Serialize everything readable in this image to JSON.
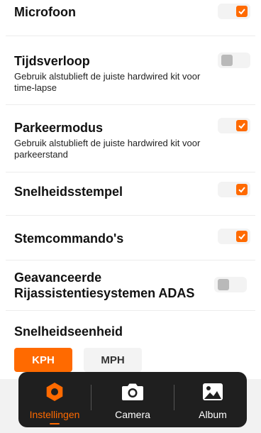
{
  "settings": {
    "microfoon": {
      "title": "Microfoon",
      "on": true
    },
    "tijdsverloop": {
      "title": "Tijdsverloop",
      "sub": "Gebruik alstublieft de juiste hardwired kit voor time-lapse",
      "on": false
    },
    "parkeermodus": {
      "title": "Parkeermodus",
      "sub": "Gebruik alstublieft de juiste hardwired kit voor parkeerstand",
      "on": true
    },
    "snelheidsstempel": {
      "title": "Snelheidsstempel",
      "on": true
    },
    "stemcommandos": {
      "title": "Stemcommando's",
      "on": true
    },
    "adas": {
      "title": "Geavanceerde Rijassistentiesystemen ADAS",
      "on": false
    }
  },
  "speed_unit": {
    "title": "Snelheidseenheid",
    "options": [
      "KPH",
      "MPH"
    ],
    "selected": "KPH"
  },
  "tabs": [
    {
      "label": "Instellingen",
      "icon": "settings-gear-icon",
      "active": true
    },
    {
      "label": "Camera",
      "icon": "camera-icon",
      "active": false
    },
    {
      "label": "Album",
      "icon": "album-image-icon",
      "active": false
    }
  ],
  "colors": {
    "accent": "#ff6a00",
    "tabbar": "#1f1f1f",
    "toggle_off": "#b9b9b9"
  }
}
